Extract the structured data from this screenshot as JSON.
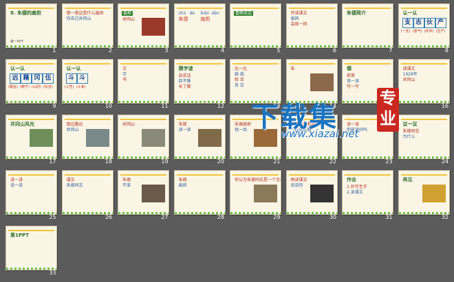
{
  "slides": [
    {
      "number": "1",
      "title": "8. 朱德的扇担",
      "footer": "第一PPT"
    },
    {
      "number": "2",
      "lines": [
        "想一想这是什么扇担",
        "你去过井冈山"
      ]
    },
    {
      "number": "3",
      "tag": "扇担",
      "lines": [
        "井冈山"
      ]
    },
    {
      "number": "4",
      "pinyin": [
        "zhū",
        "dé",
        "biǎn",
        "dān"
      ],
      "words": [
        "朱德",
        "扇担"
      ]
    },
    {
      "number": "5",
      "tag": "看图说话"
    },
    {
      "number": "6",
      "lines": [
        "开读课文",
        "扇担",
        "会挑一担"
      ]
    },
    {
      "number": "7",
      "title": "朱德简介"
    },
    {
      "number": "8",
      "title": "认一认",
      "chars": [
        "支",
        "志",
        "伙",
        "产"
      ],
      "sub": [
        "(一支)",
        "(意气)",
        "(伙伴)",
        "(生产)"
      ]
    },
    {
      "number": "9",
      "title": "认一认",
      "chars": [
        "远",
        "藉",
        "冈",
        "伍"
      ],
      "sub": [
        "(跟远)",
        "(赖于)",
        "(山冈)",
        "(队伍)"
      ]
    },
    {
      "number": "10",
      "title": "认一认",
      "chars": [
        "斗",
        "斗"
      ],
      "sub": [
        "(斗笠)",
        "(斗争)"
      ]
    },
    {
      "number": "11",
      "lines": [
        "文",
        "字",
        "书"
      ]
    },
    {
      "number": "12",
      "title": "猜字谜",
      "lines": [
        "会说话",
        "四不像",
        "长了脚"
      ]
    },
    {
      "number": "13",
      "lines": [
        "比一比",
        "扁 扇",
        "担 旦",
        "息 志"
      ]
    },
    {
      "number": "14",
      "lines": [
        "朱"
      ]
    },
    {
      "number": "15",
      "title": "德",
      "lines": [
        "部首",
        "读一读",
        "写一写"
      ]
    },
    {
      "number": "16",
      "lines": [
        "读课文",
        "1928年",
        "井冈山"
      ]
    },
    {
      "number": "17",
      "title": "井冈山风光"
    },
    {
      "number": "18",
      "lines": [
        "那边路远",
        "井冈山"
      ]
    },
    {
      "number": "19",
      "lines": [
        "井冈山"
      ]
    },
    {
      "number": "20",
      "lines": [
        "朱德",
        "读一读"
      ]
    },
    {
      "number": "21",
      "lines": [
        "朱德扁担",
        "找一找"
      ]
    },
    {
      "number": "22",
      "lines": [
        "朱德同志和战士们",
        "一起去挑粮"
      ]
    },
    {
      "number": "23",
      "lines": [
        "读一读",
        "你能读好吗"
      ]
    },
    {
      "number": "24",
      "title": "议一议",
      "lines": [
        "朱德同志",
        "为什么"
      ]
    },
    {
      "number": "25",
      "lines": [
        "讲一讲",
        "说一说"
      ]
    },
    {
      "number": "26",
      "lines": [
        "课文",
        "朱德同志"
      ]
    },
    {
      "number": "27",
      "lines": [
        "朱德",
        "不准"
      ]
    },
    {
      "number": "28",
      "lines": [
        "朱德",
        "扁担"
      ]
    },
    {
      "number": "29",
      "lines": [
        "你认为朱德同志是一个怎样的人"
      ]
    },
    {
      "number": "30",
      "lines": [
        "再读课文",
        "说说你"
      ]
    },
    {
      "number": "31",
      "title": "作业",
      "lines": [
        "1.抄写生字",
        "2.读课文"
      ]
    },
    {
      "number": "32",
      "title": "再见"
    },
    {
      "number": "33",
      "title": "第1PPT"
    }
  ],
  "watermark": {
    "text": "下载集",
    "url": "www.xiazai.net",
    "seal": "专业"
  }
}
